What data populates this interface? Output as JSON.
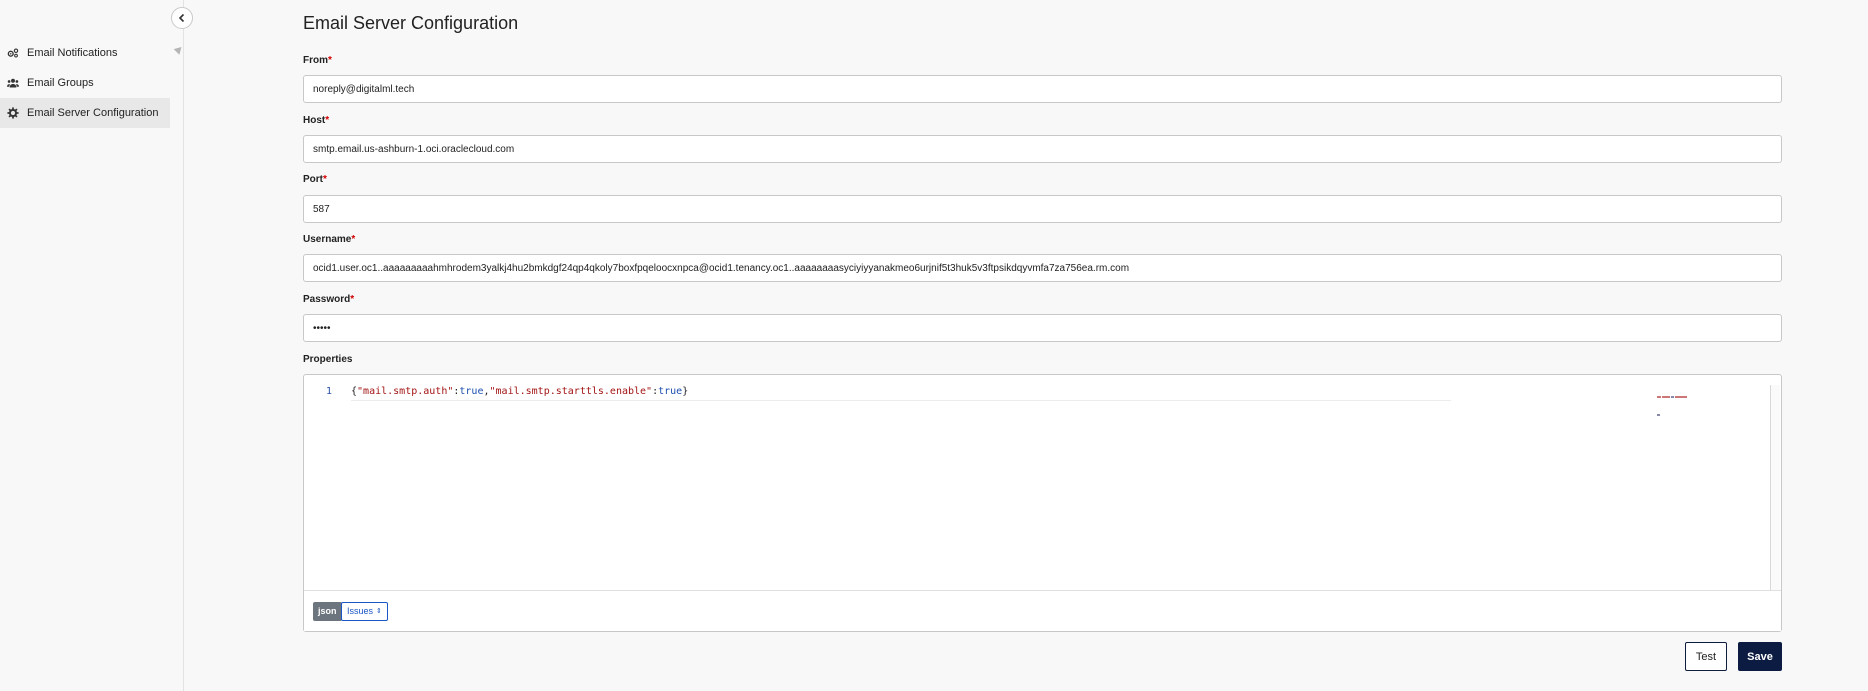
{
  "sidebar": {
    "collapse_icon": "chevron-left-icon",
    "items": [
      {
        "label": "Email Notifications",
        "icon": "gears-icon"
      },
      {
        "label": "Email Groups",
        "icon": "users-icon"
      },
      {
        "label": "Email Server Configuration",
        "icon": "gear-icon",
        "active": true
      }
    ]
  },
  "page": {
    "title": "Email Server Configuration"
  },
  "form": {
    "required_mark": "*",
    "from": {
      "label": "From",
      "value": "noreply@digitalml.tech"
    },
    "host": {
      "label": "Host",
      "value": "smtp.email.us-ashburn-1.oci.oraclecloud.com"
    },
    "port": {
      "label": "Port",
      "value": "587"
    },
    "username": {
      "label": "Username",
      "value": "ocid1.user.oc1..aaaaaaaaahmhrodem3yalkj4hu2bmkdgf24qp4qkoly7boxfpqeloocxnpca@ocid1.tenancy.oc1..aaaaaaaasyciyiyyanakmeo6urjnif5t3huk5v3ftpsikdqyvmfa7za756ea.rm.com"
    },
    "password": {
      "label": "Password",
      "value": "•••••"
    },
    "properties": {
      "label": "Properties",
      "line_number": "1",
      "tokens": {
        "open": "{",
        "key1": "\"mail.smtp.auth\"",
        "colon1": ":",
        "val1": "true",
        "comma": ",",
        "key2": "\"mail.smtp.starttls.enable\"",
        "colon2": ":",
        "val2": "true",
        "close": "}"
      },
      "language": "json",
      "issues_label": "Issues"
    }
  },
  "actions": {
    "test_label": "Test",
    "save_label": "Save"
  },
  "colors": {
    "save_bg": "#0b1b42",
    "required": "#d10000",
    "json_key": "#a31515",
    "json_bool": "#1c4fb0"
  }
}
